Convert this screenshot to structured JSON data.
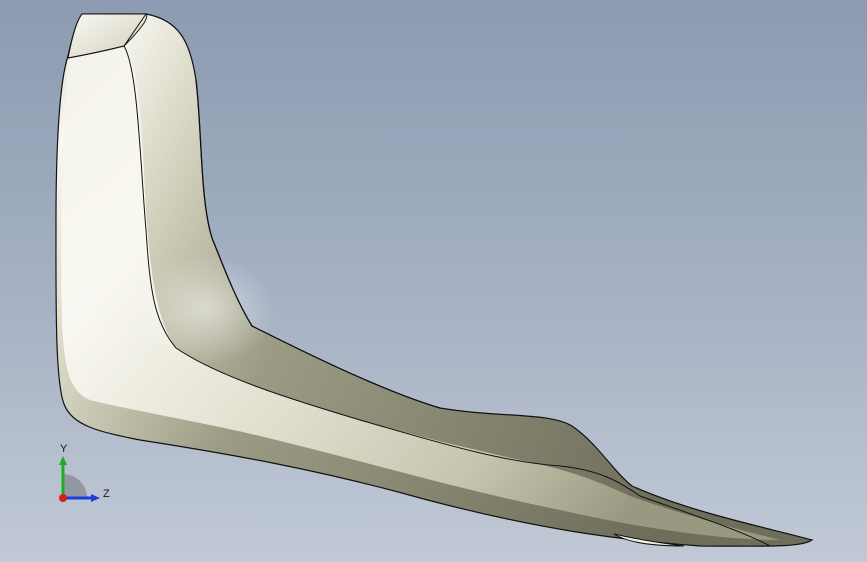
{
  "viewport": {
    "background_top": "#8c9bb1",
    "background_bottom": "#c1c9d6",
    "model": {
      "face_color_light": "#f7f6ee",
      "face_color_mid": "#d9d8c5",
      "face_color_shadow": "#7d7c67",
      "edge_color": "#111111"
    }
  },
  "triad": {
    "y_label": "Y",
    "z_label": "Z",
    "y_color": "#1faa2a",
    "z_color": "#1a3ed6",
    "x_color": "#d81b1b"
  }
}
